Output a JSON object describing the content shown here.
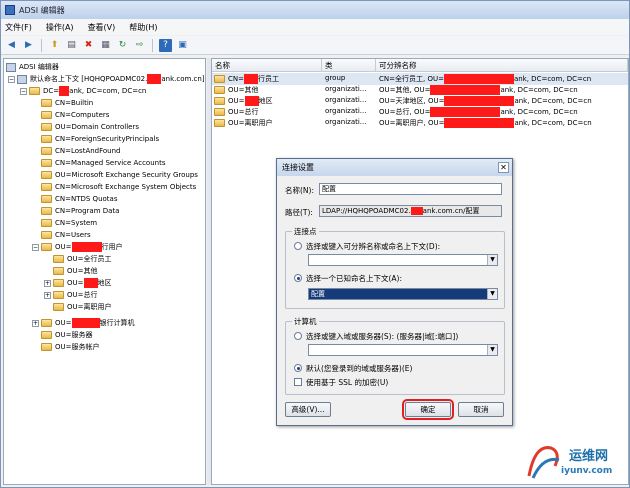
{
  "window": {
    "title": "ADSI 编辑器"
  },
  "menu": {
    "items": [
      "文件(F)",
      "操作(A)",
      "查看(V)",
      "帮助(H)"
    ]
  },
  "toolbar": {
    "icons": [
      "back-icon",
      "forward-icon",
      "up-icon",
      "properties-icon",
      "delete-icon",
      "export-icon",
      "refresh-icon",
      "export-list-icon",
      "help-icon",
      "show-hide-icon"
    ]
  },
  "tree": {
    "root": "ADSI 编辑器",
    "context": "默认命名上下文 [HQHQPOADMC02.",
    "context_suffix": "ank.com.cn]",
    "domain": "DC=",
    "domain_suffix": "ank, DC=com, DC=cn",
    "items": [
      "CN=Builtin",
      "CN=Computers",
      "OU=Domain Controllers",
      "CN=ForeignSecurityPrincipals",
      "CN=LostAndFound",
      "CN=Managed Service Accounts",
      "OU=Microsoft Exchange Security Groups",
      "CN=Microsoft Exchange System Objects",
      "CN=NTDS Quotas",
      "CN=Program Data",
      "CN=System",
      "CN=Users"
    ],
    "ou_parent": "OU=",
    "ou_parent_suffix": "行用户",
    "children": [
      "OU=全行员工",
      "OU=其他",
      "OU=",
      "OU=总行",
      "OU=离职用户"
    ],
    "child3_suffix": "地区",
    "after": [
      "OU=",
      "OU=服务器",
      "OU=服务帐户"
    ],
    "after1_suffix": "银行计算机"
  },
  "list": {
    "headers": [
      "名称",
      "类",
      "可分辨名称"
    ],
    "rows": [
      {
        "name": "CN=",
        "name_suffix": "行员工",
        "class": "group",
        "dn": "CN=全行员工, OU=",
        "dn_suffix": "ank, DC=com, DC=cn"
      },
      {
        "name": "OU=其他",
        "name_suffix": "",
        "class": "organizati...",
        "dn": "OU=其他, OU=",
        "dn_suffix": "ank, DC=com, DC=cn"
      },
      {
        "name": "OU=",
        "name_suffix": "地区",
        "class": "organizati...",
        "dn": "OU=天津地区, OU=",
        "dn_suffix": "ank, DC=com, DC=cn"
      },
      {
        "name": "OU=总行",
        "name_suffix": "",
        "class": "organizati...",
        "dn": "OU=总行, OU=",
        "dn_suffix": "ank, DC=com, DC=cn"
      },
      {
        "name": "OU=离职用户",
        "name_suffix": "",
        "class": "organizati...",
        "dn": "OU=离职用户, OU=",
        "dn_suffix": "ank, DC=com, DC=cn"
      }
    ]
  },
  "dialog": {
    "title": "连接设置",
    "name_label": "名称(N):",
    "name_value": "配置",
    "path_label": "路径(T):",
    "path_value": "LDAP://HQHQPOADMC02.",
    "path_suffix": "ank.com.cn/配置",
    "connection_group": "连接点",
    "radio1": "选择或键入可分辨名称或命名上下文(D):",
    "radio2": "选择一个已知命名上下文(A):",
    "known_context_value": "配置",
    "computer_group": "计算机",
    "radio3": "选择或键入域或服务器(S): (服务器|域[:端口])",
    "radio4": "默认(您登录到的域或服务器)(E)",
    "ssl_label": "使用基于 SSL 的加密(U)",
    "advanced_button": "高级(V)...",
    "ok_button": "确定",
    "cancel_button": "取消"
  },
  "watermark": {
    "text": "运维网",
    "url": "iyunv.com"
  },
  "colors": {
    "accent": "#163b7a",
    "redaction": "#ff1a1a",
    "highlight": "#e02020"
  }
}
